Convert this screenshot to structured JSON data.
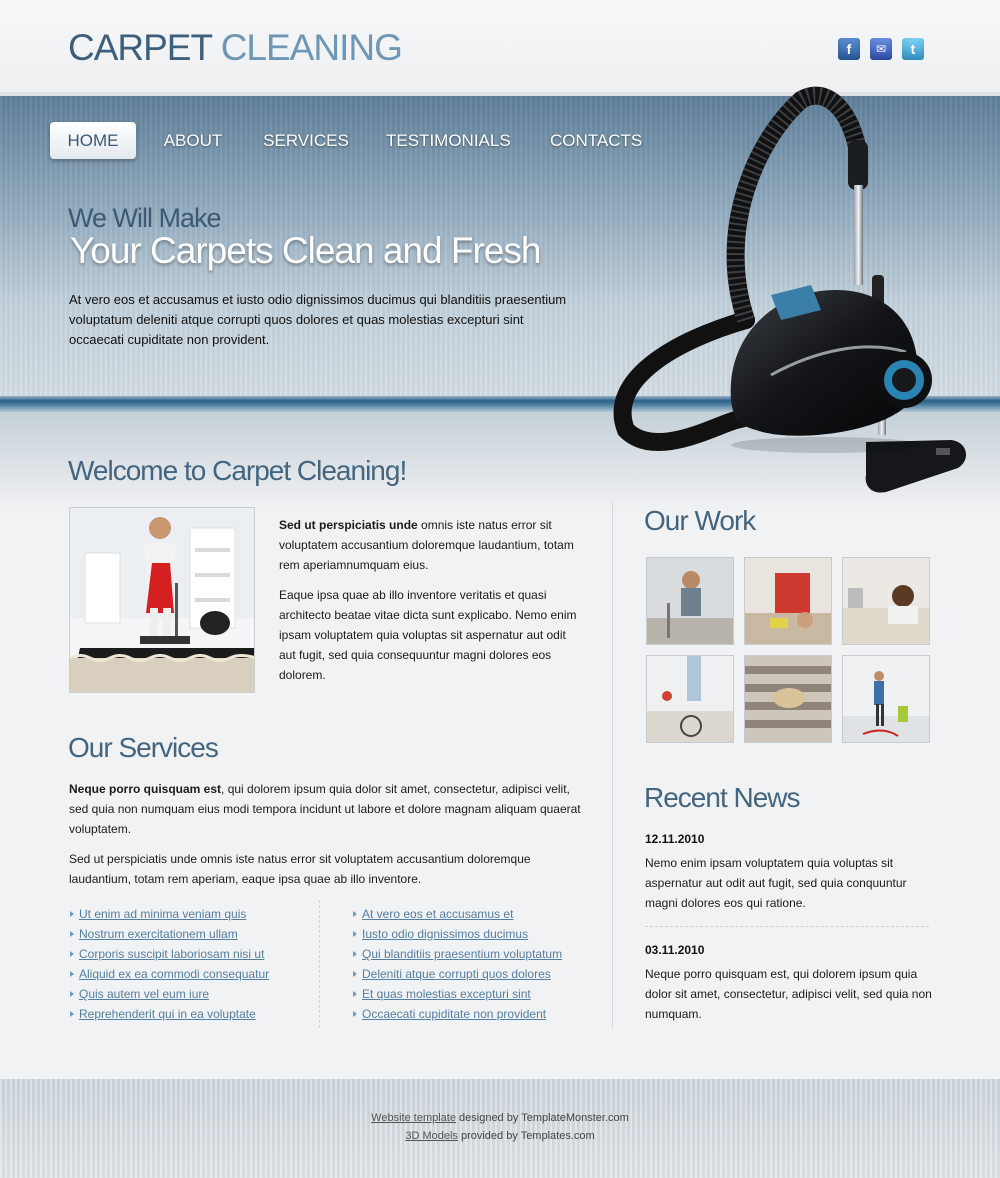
{
  "header": {
    "logo_word1": "CARPET",
    "logo_word2": "CLEANING",
    "social": [
      {
        "icon": "facebook-icon",
        "glyph": "f",
        "color": "#3b6fbd"
      },
      {
        "icon": "messenger-icon",
        "glyph": "✉",
        "color": "#4466c8"
      },
      {
        "icon": "twitter-icon",
        "glyph": "t",
        "color": "#4cb4e2"
      }
    ]
  },
  "nav": {
    "items": [
      "HOME",
      "ABOUT",
      "SERVICES",
      "TESTIMONIALS",
      "CONTACTS"
    ],
    "active": "HOME"
  },
  "hero": {
    "line1": "We Will Make",
    "line2": "Your Carpets Clean and Fresh",
    "text": "At vero eos et accusamus et iusto odio dignissimos ducimus qui blanditiis praesentium voluptatum deleniti atque corrupti quos dolores et quas molestias excepturi sint occaecati cupiditate non provident."
  },
  "welcome": {
    "title": "Welcome to Carpet Cleaning!",
    "p1_bold": "Sed ut perspiciatis unde",
    "p1_rest": " omnis iste natus error sit voluptatem accusantium doloremque laudantium, totam rem aperiamnumquam eius.",
    "p2": "Eaque ipsa quae ab illo inventore veritatis et quasi architecto beatae vitae dicta sunt explicabo. Nemo enim ipsam voluptatem quia voluptas sit aspernatur aut odit aut fugit, sed quia consequuntur magni dolores eos dolorem."
  },
  "services": {
    "title": "Our Services",
    "p1_bold": "Neque porro quisquam est",
    "p1_rest": ", qui dolorem ipsum quia dolor sit amet, consectetur, adipisci velit, sed quia non numquam eius modi tempora incidunt ut labore et dolore magnam aliquam quaerat voluptatem.",
    "p2": "Sed ut perspiciatis unde omnis iste natus error sit voluptatem accusantium doloremque laudantium, totam rem aperiam, eaque ipsa quae ab illo inventore.",
    "list_left": [
      "Ut enim ad minima veniam quis",
      "Nostrum exercitationem ullam",
      "Corporis suscipit laboriosam nisi ut",
      "Aliquid ex ea commodi consequatur",
      "Quis autem vel eum iure",
      "Reprehenderit qui in ea voluptate"
    ],
    "list_right": [
      "At vero eos et accusamus et",
      "Iusto odio dignissimos ducimus",
      "Qui blanditiis praesentium voluptatum",
      "Deleniti atque corrupti quos dolores",
      "Et quas molestias excepturi sint",
      "Occaecati cupiditate non provident"
    ]
  },
  "work": {
    "title": "Our Work"
  },
  "news": {
    "title": "Recent News",
    "items": [
      {
        "date": "12.11.2010",
        "text": "Nemo enim ipsam voluptatem quia voluptas sit aspernatur aut odit aut fugit, sed quia conquuntur magni dolores eos qui ratione."
      },
      {
        "date": "03.11.2010",
        "text": "Neque porro quisquam est, qui dolorem ipsum quia dolor sit amet, consectetur, adipisci velit, sed quia non numquam."
      }
    ]
  },
  "footer": {
    "link1": "Website template",
    "text1": " designed by TemplateMonster.com",
    "link2": "3D Models",
    "text2": " provided by Templates.com"
  }
}
